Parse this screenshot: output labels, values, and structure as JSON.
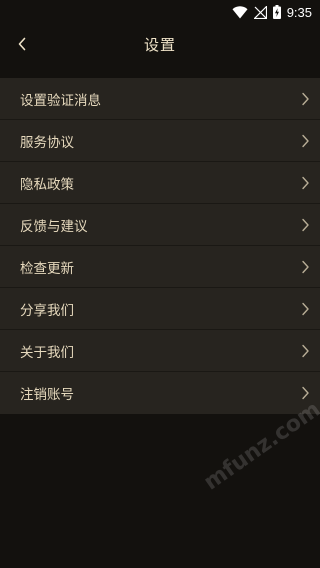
{
  "status_bar": {
    "time": "9:35",
    "icons": [
      "wifi-icon",
      "no-signal-icon",
      "battery-charging-icon"
    ]
  },
  "header": {
    "title": "设置",
    "back_icon": "chevron-left-icon"
  },
  "menu": {
    "items": [
      {
        "label": "设置验证消息"
      },
      {
        "label": "服务协议"
      },
      {
        "label": "隐私政策"
      },
      {
        "label": "反馈与建议"
      },
      {
        "label": "检查更新"
      },
      {
        "label": "分享我们"
      },
      {
        "label": "关于我们"
      },
      {
        "label": "注销账号"
      }
    ],
    "chevron_icon": "chevron-right-icon"
  },
  "watermark": {
    "text": "mfunz.com 魔趣网"
  },
  "colors": {
    "background": "#13110e",
    "list_background": "#27241f",
    "text": "#e6d9bd",
    "title": "#efe3c8",
    "chevron": "#b8ad96"
  }
}
